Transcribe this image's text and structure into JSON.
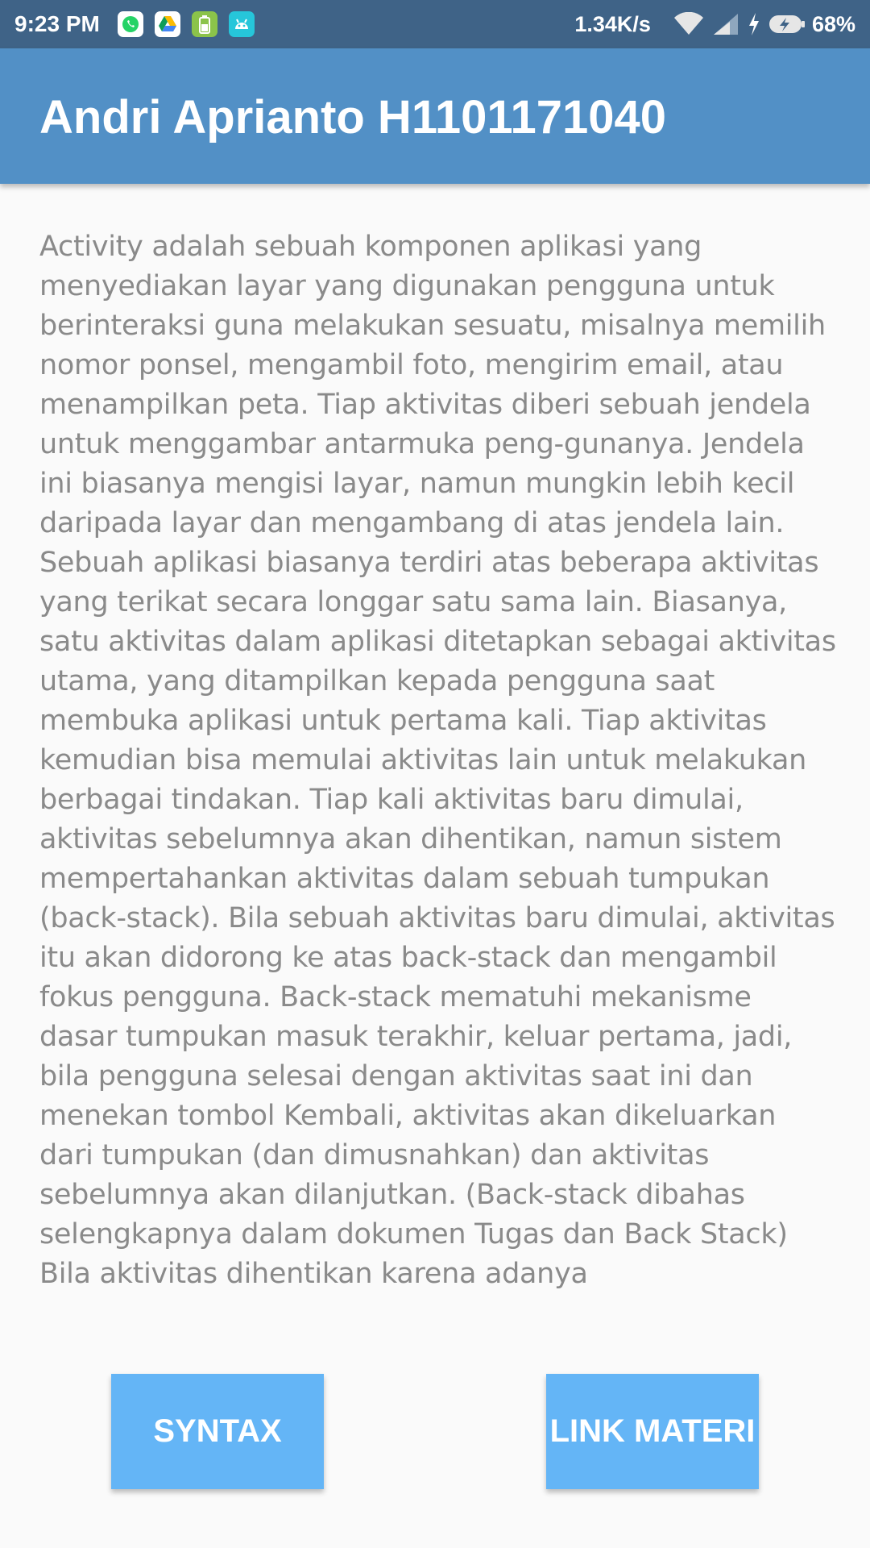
{
  "status_bar": {
    "time": "9:23 PM",
    "network_speed": "1.34K/s",
    "battery_percent": "68%",
    "notification_icons": [
      "whatsapp-icon",
      "google-drive-icon",
      "battery-app-icon",
      "android-icon"
    ],
    "system_icons": [
      "wifi-icon",
      "cell-signal-icon",
      "charging-icon",
      "battery-icon"
    ]
  },
  "app_bar": {
    "title": "Andri Aprianto H1101171040"
  },
  "content": {
    "text": "Activity adalah sebuah komponen aplikasi yang menyediakan layar yang digunakan pengguna untuk berinteraksi guna melakukan sesuatu, misalnya memilih nomor ponsel, mengambil foto, mengirim email, atau menampilkan peta. Tiap aktivitas diberi sebuah jendela untuk menggambar antarmuka peng-gunanya. Jendela ini biasanya mengisi layar, namun mungkin lebih kecil daripada layar dan mengambang di atas jendela lain. Sebuah aplikasi biasanya terdiri atas beberapa aktivitas yang terikat secara longgar satu sama lain. Biasanya, satu aktivitas dalam aplikasi ditetapkan sebagai aktivitas utama, yang ditampilkan kepada pengguna saat membuka aplikasi untuk pertama kali. Tiap aktivitas kemudian bisa memulai aktivitas lain untuk melakukan berbagai tindakan. Tiap kali aktivitas baru dimulai, aktivitas sebelumnya akan dihentikan, namun sistem mempertahankan aktivitas dalam sebuah tumpukan (back-stack). Bila sebuah aktivitas baru dimulai, aktivitas itu akan didorong ke atas back-stack dan mengambil fokus pengguna. Back-stack mematuhi mekanisme dasar tumpukan masuk terakhir, keluar pertama, jadi, bila pengguna selesai dengan aktivitas saat ini dan menekan tombol Kembali, aktivitas akan dikeluarkan dari tumpukan (dan dimusnahkan) dan aktivitas sebelumnya akan dilanjutkan. (Back-stack dibahas selengkapnya dalam dokumen Tugas dan Back Stack) Bila aktivitas dihentikan karena adanya"
  },
  "buttons": {
    "syntax_label": "SYNTAX",
    "link_materi_label": "LINK MATERI"
  },
  "colors": {
    "status_bar": "#3f6387",
    "app_bar": "#5290c6",
    "button": "#64b5f6",
    "background": "#fafafa",
    "text": "#8a8a8a"
  }
}
